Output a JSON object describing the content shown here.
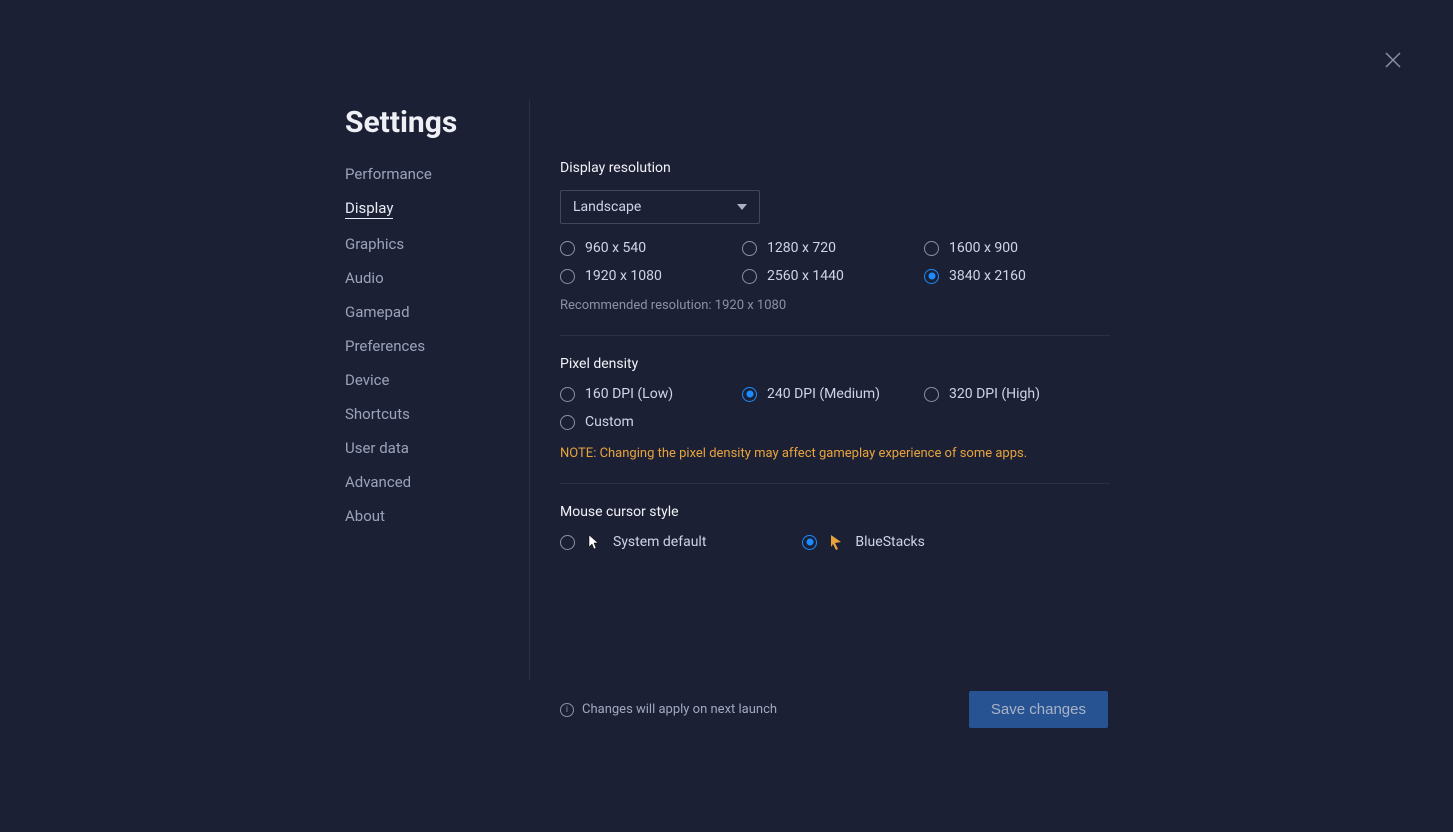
{
  "title": "Settings",
  "sidebar": {
    "items": [
      {
        "label": "Performance",
        "active": false
      },
      {
        "label": "Display",
        "active": true
      },
      {
        "label": "Graphics",
        "active": false
      },
      {
        "label": "Audio",
        "active": false
      },
      {
        "label": "Gamepad",
        "active": false
      },
      {
        "label": "Preferences",
        "active": false
      },
      {
        "label": "Device",
        "active": false
      },
      {
        "label": "Shortcuts",
        "active": false
      },
      {
        "label": "User data",
        "active": false
      },
      {
        "label": "Advanced",
        "active": false
      },
      {
        "label": "About",
        "active": false
      }
    ]
  },
  "resolution": {
    "label": "Display resolution",
    "dropdown_value": "Landscape",
    "options": [
      {
        "label": "960 x 540",
        "selected": false
      },
      {
        "label": "1280 x 720",
        "selected": false
      },
      {
        "label": "1600 x 900",
        "selected": false
      },
      {
        "label": "1920 x 1080",
        "selected": false
      },
      {
        "label": "2560 x 1440",
        "selected": false
      },
      {
        "label": "3840 x 2160",
        "selected": true
      }
    ],
    "recommended": "Recommended resolution: 1920 x 1080"
  },
  "density": {
    "label": "Pixel density",
    "options": [
      {
        "label": "160 DPI (Low)",
        "selected": false
      },
      {
        "label": "240 DPI (Medium)",
        "selected": true
      },
      {
        "label": "320 DPI (High)",
        "selected": false
      },
      {
        "label": "Custom",
        "selected": false
      }
    ],
    "note": "NOTE: Changing the pixel density may affect gameplay experience of some apps."
  },
  "cursor": {
    "label": "Mouse cursor style",
    "options": [
      {
        "label": "System default",
        "selected": false
      },
      {
        "label": "BlueStacks",
        "selected": true
      }
    ]
  },
  "footer": {
    "notice": "Changes will apply on next launch",
    "save_label": "Save changes"
  }
}
